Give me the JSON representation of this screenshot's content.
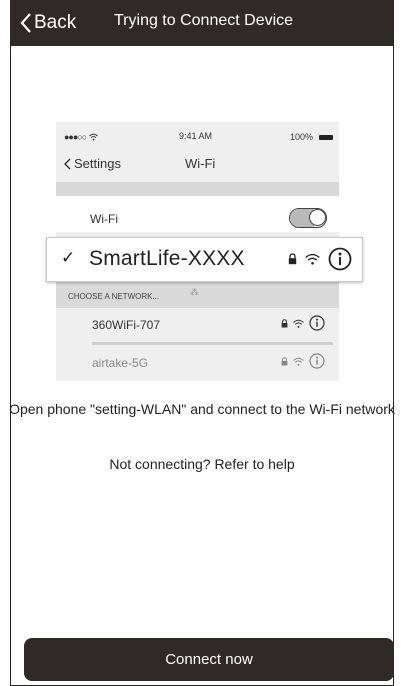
{
  "nav": {
    "back_label": "Back",
    "title": "Trying to Connect Device"
  },
  "phone": {
    "status": {
      "signal": "●●●○○",
      "time": "9:41 AM",
      "battery": "100%"
    },
    "nav_back": "Settings",
    "nav_title": "Wi-Fi",
    "wifi_label": "Wi-Fi",
    "wifi_on": true,
    "choose_network": "CHOOSE A NETWORK...",
    "networks": [
      {
        "name": "360WiFi-707"
      },
      {
        "name": "airtake-5G"
      }
    ]
  },
  "highlight": {
    "check": "✓",
    "name": "SmartLife-XXXX"
  },
  "instruction": "Open phone \"setting-WLAN\" and connect to the Wi-Fi network",
  "help_text": "Not connecting? Refer to help",
  "connect_button": "Connect now",
  "colors": {
    "bar": "#2f2927",
    "button": "#2f2927"
  }
}
